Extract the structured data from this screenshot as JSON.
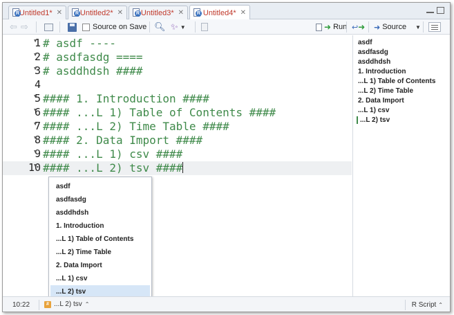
{
  "tabs": [
    {
      "label": "Untitled1*",
      "active": false
    },
    {
      "label": "Untitled2*",
      "active": false
    },
    {
      "label": "Untitled3*",
      "active": false
    },
    {
      "label": "Untitled4*",
      "active": true
    }
  ],
  "toolbar": {
    "source_on_save": "Source on Save",
    "run": "Run",
    "source": "Source"
  },
  "editor": {
    "lines": [
      {
        "num": "1",
        "text": "# asdf ----"
      },
      {
        "num": "2",
        "text": "# asdfasdg ===="
      },
      {
        "num": "3",
        "text": "# asddhdsh ####"
      },
      {
        "num": "4",
        "text": ""
      },
      {
        "num": "5",
        "text": "#### 1. Introduction ####"
      },
      {
        "num": "6",
        "text": "#### ...L 1) Table of Contents ####"
      },
      {
        "num": "7",
        "text": "#### ...L 2) Time Table ####"
      },
      {
        "num": "8",
        "text": "#### 2. Data Import ####"
      },
      {
        "num": "9",
        "text": "#### ...L 1) csv ####"
      },
      {
        "num": "10",
        "text": "#### ...L 2) tsv ####"
      }
    ]
  },
  "popup": {
    "items": [
      "asdf",
      "asdfasdg",
      "asddhdsh",
      "1. Introduction",
      "...L 1) Table of Contents",
      "...L 2) Time Table",
      "2. Data Import",
      "...L 1) csv",
      "...L 2) tsv"
    ],
    "selected_index": 8
  },
  "outline": {
    "items": [
      "asdf",
      "asdfasdg",
      "asddhdsh",
      "1. Introduction",
      "...L 1) Table of Contents",
      "...L 2) Time Table",
      "2. Data Import",
      "...L 1) csv",
      "...L 2) tsv"
    ]
  },
  "status": {
    "position": "10:22",
    "scope": "...L 2) tsv",
    "file_type": "R Script"
  },
  "colors": {
    "comment_green": "#3f8a4a",
    "tab_label_red": "#c0392b",
    "selection_blue": "#d6e6f7"
  }
}
